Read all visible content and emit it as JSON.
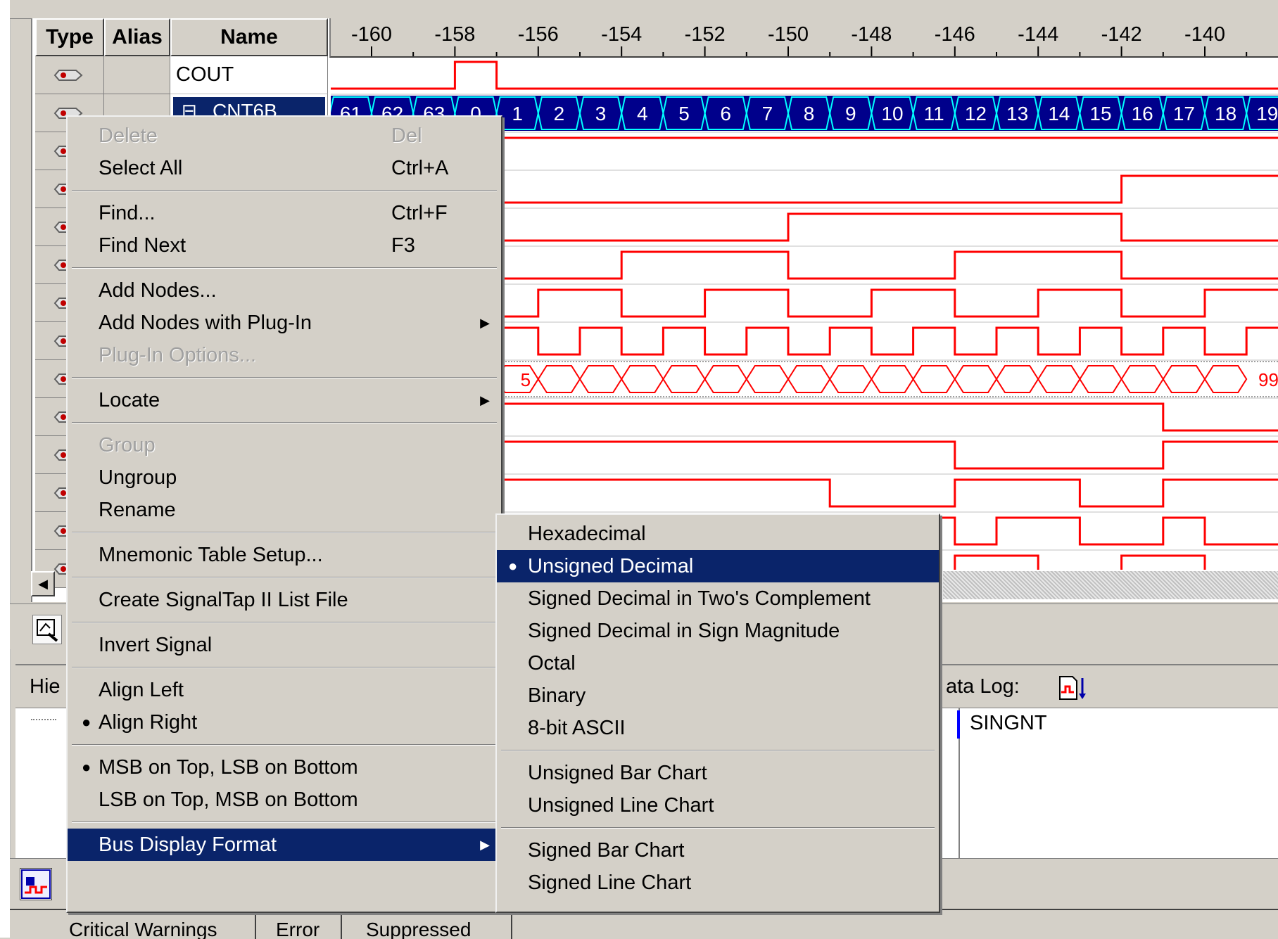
{
  "columns": {
    "type": "Type",
    "alias": "Alias",
    "name": "Name"
  },
  "timeline": {
    "ticks": [
      "-160",
      "-158",
      "-156",
      "-154",
      "-152",
      "-150",
      "-148",
      "-146",
      "-144",
      "-142",
      "-140"
    ]
  },
  "signals": [
    {
      "name": "COUT"
    },
    {
      "name": "CNT6B",
      "expand": "⊟"
    }
  ],
  "bus_values": {
    "cnt6b": [
      "61",
      "62",
      "63",
      "0",
      "1",
      "2",
      "3",
      "4",
      "5",
      "6",
      "7",
      "8",
      "9",
      "10",
      "11",
      "12",
      "13",
      "14",
      "15",
      "16",
      "17",
      "18",
      "19"
    ],
    "row9_left": "5",
    "row9_right": "99"
  },
  "context_menu": {
    "items": [
      {
        "label": "Delete",
        "shortcut": "Del",
        "disabled": true
      },
      {
        "label": "Select All",
        "shortcut": "Ctrl+A"
      },
      {
        "sep": true
      },
      {
        "label": "Find...",
        "shortcut": "Ctrl+F"
      },
      {
        "label": "Find Next",
        "shortcut": "F3"
      },
      {
        "sep": true
      },
      {
        "label": "Add Nodes..."
      },
      {
        "label": "Add Nodes with Plug-In",
        "submenu": true
      },
      {
        "label": "Plug-In Options...",
        "disabled": true
      },
      {
        "sep": true
      },
      {
        "label": "Locate",
        "submenu": true
      },
      {
        "sep": true
      },
      {
        "label": "Group",
        "disabled": true
      },
      {
        "label": "Ungroup"
      },
      {
        "label": "Rename"
      },
      {
        "sep": true
      },
      {
        "label": "Mnemonic Table Setup..."
      },
      {
        "sep": true
      },
      {
        "label": "Create SignalTap II List File"
      },
      {
        "sep": true
      },
      {
        "label": "Invert Signal"
      },
      {
        "sep": true
      },
      {
        "label": "Align Left"
      },
      {
        "label": "Align Right",
        "checked": true
      },
      {
        "sep": true
      },
      {
        "label": "MSB on Top, LSB on Bottom",
        "checked": true
      },
      {
        "label": "LSB on Top, MSB on Bottom"
      },
      {
        "sep": true
      },
      {
        "label": "Bus Display Format",
        "submenu": true,
        "selected": true
      }
    ]
  },
  "submenu": {
    "items": [
      {
        "label": "Hexadecimal"
      },
      {
        "label": "Unsigned Decimal",
        "checked": true,
        "selected": true
      },
      {
        "label": "Signed Decimal in Two's Complement"
      },
      {
        "label": "Signed Decimal in Sign Magnitude"
      },
      {
        "label": "Octal"
      },
      {
        "label": "Binary"
      },
      {
        "label": "8-bit ASCII"
      },
      {
        "sep": true
      },
      {
        "label": "Unsigned Bar Chart"
      },
      {
        "label": "Unsigned Line Chart"
      },
      {
        "sep": true
      },
      {
        "label": "Signed Bar Chart"
      },
      {
        "label": "Signed Line Chart"
      }
    ]
  },
  "lower_panel": {
    "hier_label": "Hie",
    "data_log_label": "ata Log:",
    "instance_name": "SINGNT"
  },
  "bottom_tabs": [
    "Critical Warnings",
    "Error",
    "Suppressed"
  ],
  "colors": {
    "waveform": "#ff0000",
    "bus_fill": "#00008b",
    "selection": "#0a246a",
    "bus_text": "#00ffff"
  }
}
